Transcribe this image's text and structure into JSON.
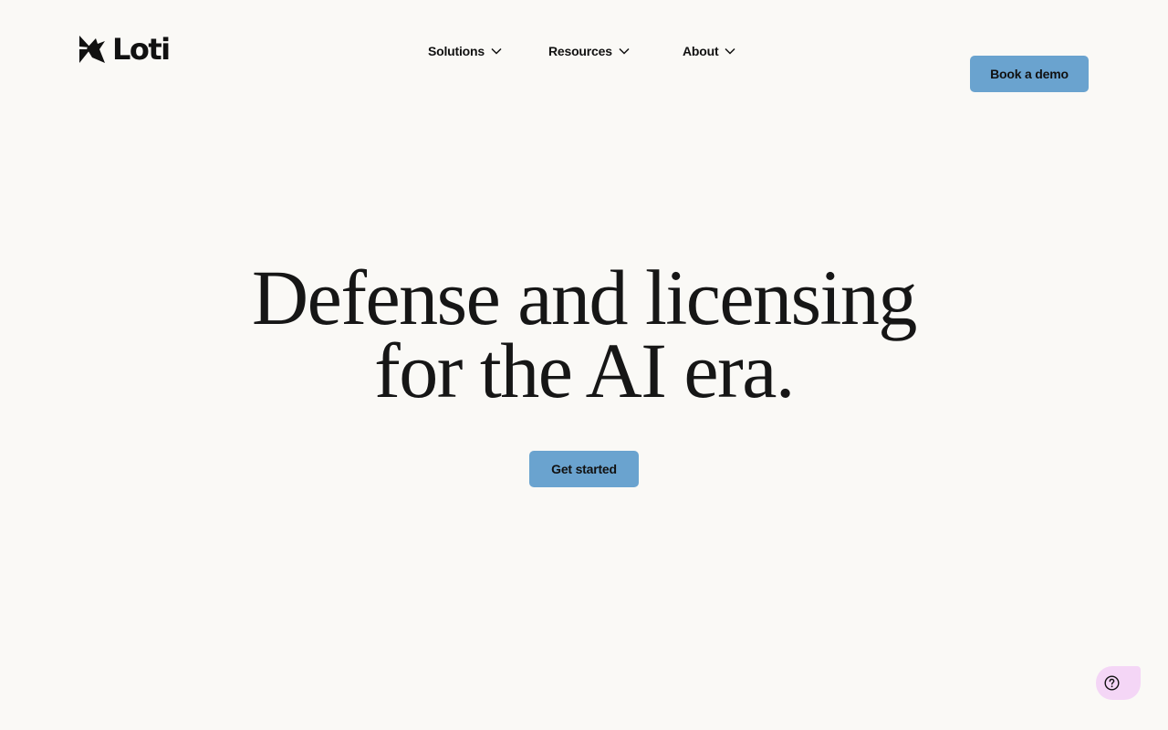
{
  "brand": {
    "name": "Loti",
    "logo_icon": "loti-bird-mark-icon"
  },
  "nav": {
    "items": [
      {
        "label": "Solutions",
        "icon": "chevron-down-icon"
      },
      {
        "label": "Resources",
        "icon": "chevron-down-icon"
      },
      {
        "label": "About",
        "icon": "chevron-down-icon"
      }
    ]
  },
  "header": {
    "cta_label": "Book a demo"
  },
  "hero": {
    "title_line1": "Defense and licensing",
    "title_line2": "for the AI era.",
    "cta_label": "Get started"
  },
  "help": {
    "icon": "question-circle-icon"
  },
  "colors": {
    "background": "#faf9f6",
    "button": "#6aa3cf",
    "text": "#111111",
    "help_bubble": "#f4d6f6"
  }
}
